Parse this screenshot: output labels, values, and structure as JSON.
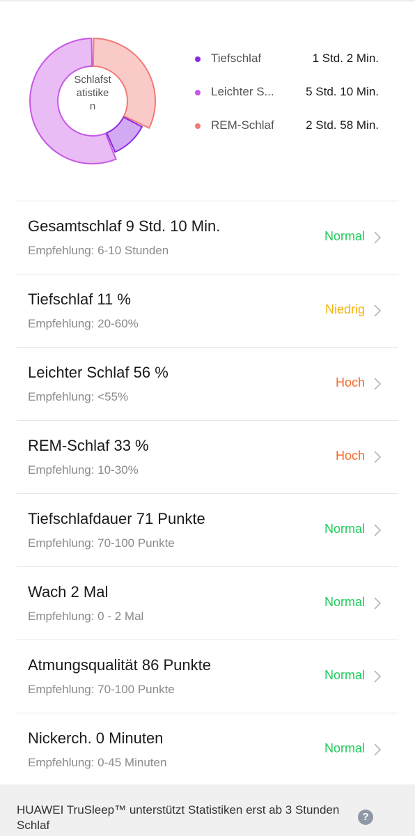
{
  "chart_data": {
    "type": "pie",
    "title": "Schlafstatistiken",
    "series": [
      {
        "name": "Tiefschlaf",
        "value": 62,
        "value_label": "1 Std. 2 Min.",
        "color": "#8b2be2"
      },
      {
        "name": "Leichter S...",
        "value": 310,
        "value_label": "5 Std. 10 Min.",
        "color": "#c757e6"
      },
      {
        "name": "REM-Schlaf",
        "value": 178,
        "value_label": "2 Std. 58 Min.",
        "color": "#f27a76"
      }
    ]
  },
  "items": [
    {
      "title": "Gesamtschlaf 9 Std. 10 Min.",
      "sub": "Empfehlung: 6-10 Stunden",
      "status": "Normal",
      "color": "#1fcc5b"
    },
    {
      "title": "Tiefschlaf 11 %",
      "sub": "Empfehlung: 20-60%",
      "status": "Niedrig",
      "color": "#f5b20b"
    },
    {
      "title": "Leichter Schlaf 56 %",
      "sub": "Empfehlung: <55%",
      "status": "Hoch",
      "color": "#f56a2a"
    },
    {
      "title": "REM-Schlaf 33 %",
      "sub": "Empfehlung: 10-30%",
      "status": "Hoch",
      "color": "#f56a2a"
    },
    {
      "title": "Tiefschlafdauer 71 Punkte",
      "sub": "Empfehlung: 70-100 Punkte",
      "status": "Normal",
      "color": "#1fcc5b"
    },
    {
      "title": "Wach 2 Mal",
      "sub": "Empfehlung: 0 - 2 Mal",
      "status": "Normal",
      "color": "#1fcc5b"
    },
    {
      "title": "Atmungsqualität 86 Punkte",
      "sub": "Empfehlung: 70-100 Punkte",
      "status": "Normal",
      "color": "#1fcc5b"
    },
    {
      "title": "Nickerch. 0 Minuten",
      "sub": "Empfehlung: 0-45 Minuten",
      "status": "Normal",
      "color": "#1fcc5b"
    }
  ],
  "footer": {
    "text": "HUAWEI TruSleep™ unterstützt Statistiken erst ab 3 Stunden Schlaf",
    "help_icon": "question-mark-icon"
  }
}
